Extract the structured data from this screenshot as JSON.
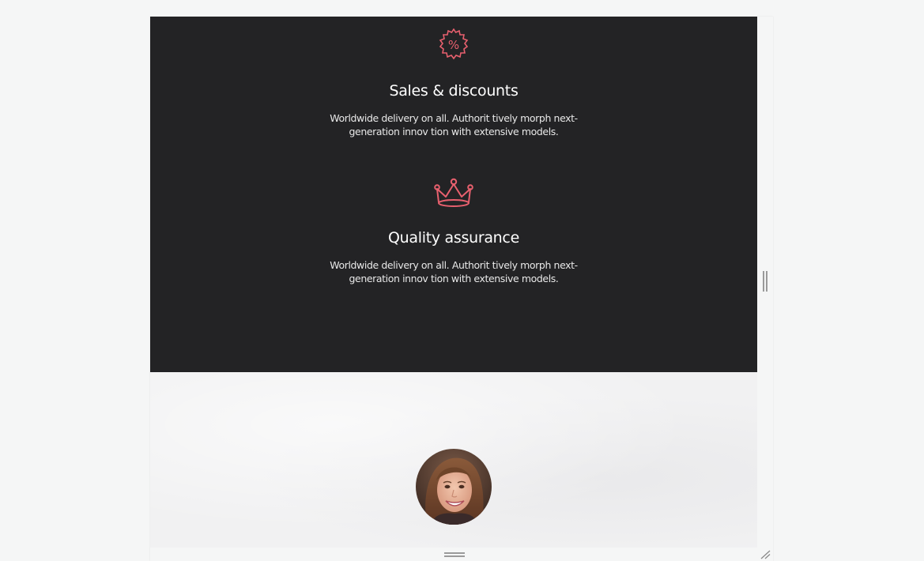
{
  "features": [
    {
      "icon": "discount-badge-icon",
      "title": "Sales & discounts",
      "text": "Worldwide delivery on all. Authorit tively morph next-generation innov tion with extensive models."
    },
    {
      "icon": "crown-icon",
      "title": "Quality assurance",
      "text": "Worldwide delivery on all. Authorit tively morph next-generation innov tion with extensive models."
    }
  ],
  "colors": {
    "dark_bg": "#232325",
    "accent": "#e8606e",
    "page_bg": "#f5f6f6"
  }
}
